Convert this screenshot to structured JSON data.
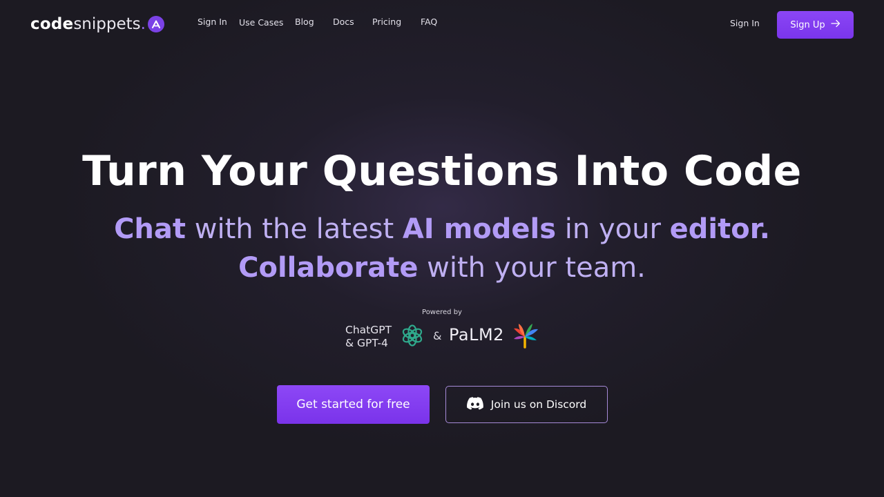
{
  "brand": {
    "logo_code": "code",
    "logo_snippets": "snippets",
    "logo_dot": ".",
    "accent_color": "#7b42e6"
  },
  "nav": {
    "items": [
      {
        "label": "Sign In"
      },
      {
        "label": "Use Cases"
      },
      {
        "label": "Blog"
      },
      {
        "label": "Docs"
      },
      {
        "label": "Pricing"
      },
      {
        "label": "FAQ"
      }
    ]
  },
  "header": {
    "sign_in_label": "Sign In",
    "sign_up_label": "Sign Up",
    "sign_up_icon": "arrow-right-icon"
  },
  "hero": {
    "title": "Turn Your Questions Into Code",
    "sub_line1": {
      "chat": "Chat",
      "with_latest": " with the latest ",
      "ai_models": "AI models",
      "in_your": " in your ",
      "editor": "editor."
    },
    "sub_line2": {
      "collaborate": "Collaborate",
      "with_team": " with your team."
    }
  },
  "powered": {
    "label": "Powered by",
    "chatgpt_line1": "ChatGPT",
    "chatgpt_line2": "& GPT-4",
    "openai_icon": "openai-logo-icon",
    "ampersand": "&",
    "palm": "PaLM2",
    "palm_icon": "palm-logo-icon"
  },
  "cta": {
    "primary_label": "Get started for free",
    "secondary_label": "Join us on Discord",
    "secondary_icon": "discord-icon",
    "primary_color": "#8b46f5",
    "secondary_border": "#a78bd9"
  }
}
